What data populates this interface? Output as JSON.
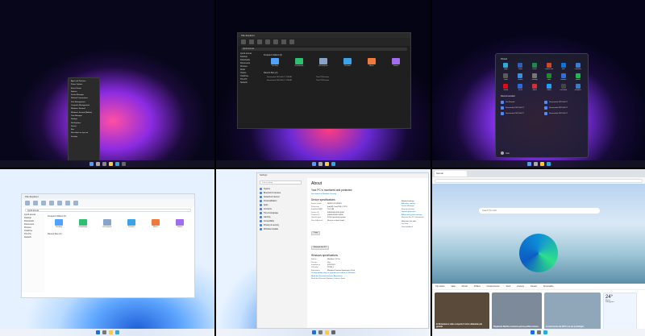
{
  "pane1": {
    "context_menu": [
      "Apps and Features",
      "Power Options",
      "Event Viewer",
      "System",
      "Device Manager",
      "Network Connections",
      "Disk Management",
      "Computer Management",
      "Windows Terminal",
      "Windows Terminal (Admin)",
      "Task Manager",
      "Settings",
      "File Explorer",
      "Search",
      "Run",
      "Shut down or sign out",
      "Desktop"
    ]
  },
  "pane2": {
    "window_title": "File Explorer",
    "address": "Quick access",
    "section_title": "Frequent folders (6)",
    "recent_title": "Recent files (2)",
    "folders": [
      {
        "label": "Desktop",
        "color": "#4fa3ff"
      },
      {
        "label": "Downloads",
        "color": "#2fbf71"
      },
      {
        "label": "Documents",
        "color": "#8aa4c8"
      },
      {
        "label": "Pictures",
        "color": "#3ba3e8"
      },
      {
        "label": "Music",
        "color": "#f07a3a"
      },
      {
        "label": "Videos",
        "color": "#a36bf0"
      }
    ],
    "nav": [
      "Quick access",
      "Desktop",
      "Downloads",
      "Documents",
      "Pictures",
      "Music",
      "Videos",
      "OneDrive",
      "This PC",
      "Network"
    ],
    "recent_files": [
      {
        "name": "Screenshot 2021-06-17 173438",
        "location": "This PC\\Pictures"
      },
      {
        "name": "Screenshot 2021-06-17 173448",
        "location": "This PC\\Pictures"
      }
    ]
  },
  "pane3": {
    "pinned_label": "Pinned",
    "all_apps": "All apps",
    "pinned": [
      {
        "label": "Edge",
        "color": "#2ea8e0"
      },
      {
        "label": "Word",
        "color": "#2b5fb8"
      },
      {
        "label": "Excel",
        "color": "#1d8a4c"
      },
      {
        "label": "PowerPoint",
        "color": "#d24726"
      },
      {
        "label": "Mail",
        "color": "#0a74da"
      },
      {
        "label": "Calendar",
        "color": "#3b7ad6"
      },
      {
        "label": "Store",
        "color": "#5a5a5a"
      },
      {
        "label": "Photos",
        "color": "#3a8fe0"
      },
      {
        "label": "Settings",
        "color": "#777"
      },
      {
        "label": "Xbox",
        "color": "#1f8a2e"
      },
      {
        "label": "Solitaire",
        "color": "#2f6fd6"
      },
      {
        "label": "Spotify",
        "color": "#1db954"
      },
      {
        "label": "Netflix",
        "color": "#e50914"
      },
      {
        "label": "To Do",
        "color": "#2b6ad6"
      },
      {
        "label": "News",
        "color": "#cc3333"
      },
      {
        "label": "Twitter",
        "color": "#1da1f2"
      },
      {
        "label": "Calculator",
        "color": "#444"
      },
      {
        "label": "Notepad",
        "color": "#3c7ac9"
      }
    ],
    "recommended_label": "Recommended",
    "recommended": [
      "Get Started",
      "Screenshot 2021-06-17",
      "Screenshot 2021-06-17",
      "Screenshot 2021-06-17",
      "Screenshot 2021-06-17",
      "Screenshot 2021-06-17"
    ],
    "user": "User"
  },
  "pane4": {
    "window_title": "File Explorer",
    "address": "Quick access",
    "section_title": "Frequent folders (6)",
    "recent_title": "Recent files (2)",
    "folders": [
      {
        "label": "Desktop",
        "color": "#4fa3ff"
      },
      {
        "label": "Downloads",
        "color": "#2fbf71"
      },
      {
        "label": "Documents",
        "color": "#8aa4c8"
      },
      {
        "label": "Pictures",
        "color": "#3ba3e8"
      },
      {
        "label": "Music",
        "color": "#f07a3a"
      },
      {
        "label": "Videos",
        "color": "#a36bf0"
      }
    ],
    "nav": [
      "Quick access",
      "Desktop",
      "Downloads",
      "Documents",
      "Pictures",
      "OneDrive",
      "This PC",
      "Network"
    ]
  },
  "pane5": {
    "window_title": "Settings",
    "search_placeholder": "Find a setting",
    "nav": [
      "System",
      "Bluetooth & devices",
      "Network & internet",
      "Personalization",
      "Apps",
      "Accounts",
      "Time & language",
      "Gaming",
      "Accessibility",
      "Privacy & security",
      "Windows Update"
    ],
    "about_title": "About",
    "protected": "Your PC is monitored and protected",
    "see_details": "See details in Windows Security",
    "device_specs_title": "Device specifications",
    "specs": [
      {
        "k": "Device name",
        "v": "DESKTOP-WIN11"
      },
      {
        "k": "Processor",
        "v": "Intel(R) Core(TM) i7 CPU"
      },
      {
        "k": "Installed RAM",
        "v": "16.0 GB"
      },
      {
        "k": "Device ID",
        "v": "00000000-0000-0000"
      },
      {
        "k": "Product ID",
        "v": "00000-00000-00000"
      },
      {
        "k": "System type",
        "v": "64-bit operating system"
      },
      {
        "k": "Pen and touch",
        "v": "No pen or touch input"
      }
    ],
    "copy": "Copy",
    "rename": "Rename this PC",
    "win_specs_title": "Windows specifications",
    "win_specs": [
      {
        "k": "Edition",
        "v": "Windows 11 Pro"
      },
      {
        "k": "Version",
        "v": "Dev"
      },
      {
        "k": "Installed on",
        "v": "6/15/2021"
      },
      {
        "k": "OS build",
        "v": "21996.1"
      },
      {
        "k": "Experience",
        "v": "Windows Feature Experience Pack"
      }
    ],
    "links": [
      "Change product key or upgrade your edition of Windows",
      "Read the Microsoft Services Agreement",
      "Read the Microsoft Software License Terms"
    ],
    "right_header": "Related settings",
    "right_links": [
      "BitLocker settings",
      "Device Manager",
      "Remote desktop",
      "System protection",
      "Advanced system settings",
      "Rename this PC (advanced)"
    ],
    "help_header": "Help from the web",
    "help_links": [
      "Get help",
      "Give feedback"
    ]
  },
  "pane6": {
    "tab_title": "New tab",
    "search_placeholder": "Search the web",
    "categories": [
      "Top stories",
      "Italia",
      "Mondo",
      "Politica",
      "Intrattenimento",
      "Sport",
      "Lifestyle",
      "Denaro",
      "Personalize"
    ],
    "cards": [
      {
        "title": "In Botswana è stato scoperto il terzo diamante più grande",
        "color": "#5a4a3a"
      },
      {
        "title": "Stephanie Merkle nomina la prima politica donna",
        "color": "#7d8a9a"
      },
      {
        "title": "Le banconote da 200 € ora nel portafoglio",
        "color": "#8fa7b8"
      }
    ],
    "weather": {
      "temp": "24°",
      "city": "Roma",
      "condition": "Soleggiato"
    }
  }
}
